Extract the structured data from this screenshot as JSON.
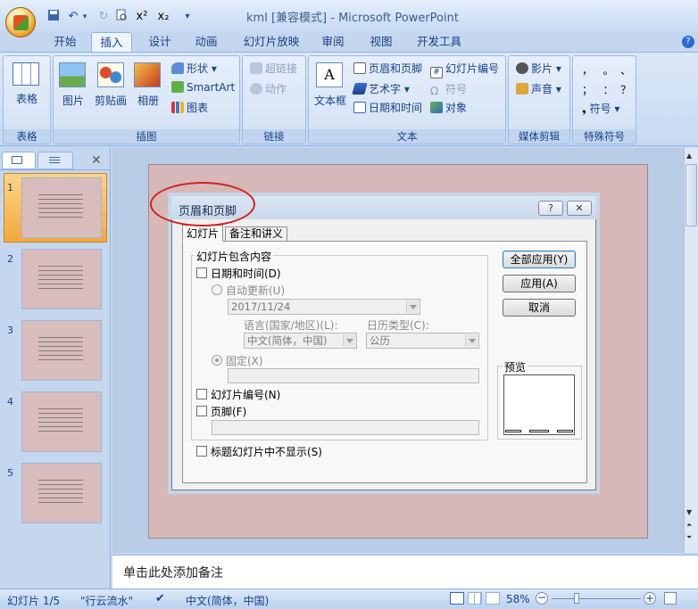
{
  "window": {
    "title": "kml [兼容模式] - Microsoft PowerPoint"
  },
  "qat": {
    "undo": "↶",
    "redo": "↻",
    "superscript": "x²",
    "subscript": "x₂",
    "more": "▾"
  },
  "tabs": [
    "开始",
    "插入",
    "设计",
    "动画",
    "幻灯片放映",
    "审阅",
    "视图",
    "开发工具"
  ],
  "ribbon": {
    "groups": {
      "table": "表格",
      "illustrations": "插图",
      "links": "链接",
      "text": "文本",
      "media": "媒体剪辑",
      "symbols": "特殊符号"
    },
    "table_btn": "表格",
    "picture": "图片",
    "clipart": "剪贴画",
    "album": "相册",
    "shapes": "形状",
    "smartart": "SmartArt",
    "chart": "图表",
    "hyperlink": "超链接",
    "action": "动作",
    "textbox": "文本框",
    "header_footer": "页眉和页脚",
    "wordart": "艺术字",
    "datetime": "日期和时间",
    "slide_number": "幻灯片编号",
    "symbol": "符号",
    "object": "对象",
    "movie": "影片",
    "sound": "声音",
    "sym_row1": "，   。  、",
    "sym_row2": "；   ：  ？",
    "sym_more": "符号"
  },
  "slides": {
    "numbers": [
      "1",
      "2",
      "3",
      "4",
      "5"
    ]
  },
  "notes": {
    "placeholder": "单击此处添加备注"
  },
  "status": {
    "slide": "幻灯片 1/5",
    "theme": "\"行云流水\"",
    "lang": "中文(简体，中国)",
    "zoom": "58%"
  },
  "dialog": {
    "title": "页眉和页脚",
    "tab_slide": "幻灯片",
    "tab_notes": "备注和讲义",
    "group_label": "幻灯片包含内容",
    "datetime_label": "日期和时间(D)",
    "auto_update": "自动更新(U)",
    "date_value": "2017/11/24",
    "lang_label": "语言(国家/地区)(L):",
    "calendar_label": "日历类型(C):",
    "lang_value": "中文(简体，中国)",
    "calendar_value": "公历",
    "fixed": "固定(X)",
    "slide_number": "幻灯片编号(N)",
    "footer": "页脚(F)",
    "hide_title": "标题幻灯片中不显示(S)",
    "apply_all": "全部应用(Y)",
    "apply": "应用(A)",
    "cancel": "取消",
    "preview": "预览",
    "help_btn": "?",
    "close_btn": "✕"
  },
  "colors": {
    "annotation": "#d42020",
    "selected_thumb": "#f4a83d",
    "slide_bg": "#d6b8b8"
  }
}
